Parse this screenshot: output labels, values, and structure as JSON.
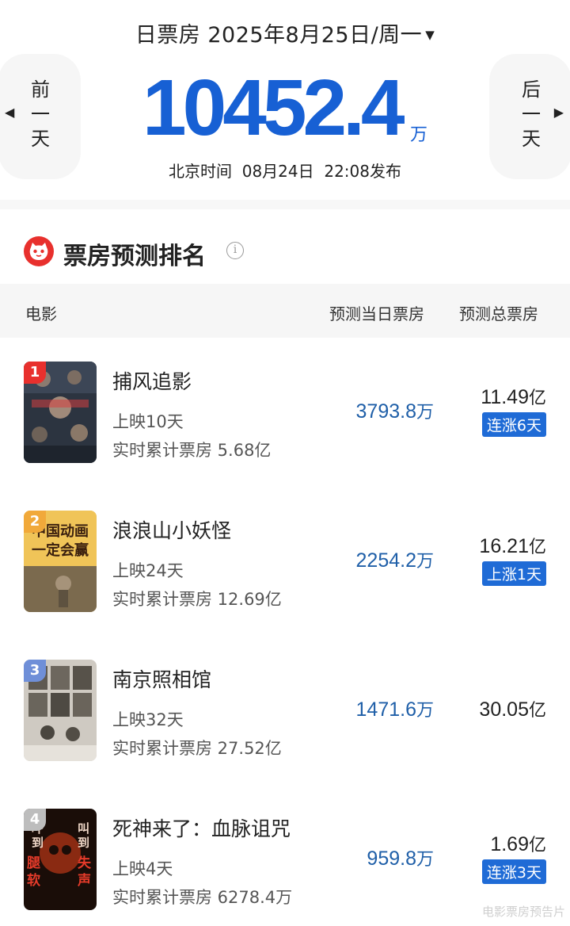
{
  "header": {
    "date_label": "日票房 2025年8月25日/周一",
    "caret": "▼",
    "prev_label": [
      "前",
      "一",
      "天"
    ],
    "next_label": [
      "后",
      "一",
      "天"
    ],
    "prev_arrow": "◀",
    "next_arrow": "▶",
    "total_value": "10452.4",
    "total_unit": "万",
    "release_info": "北京时间  08月24日  22:08发布"
  },
  "section": {
    "title": "票房预测排名",
    "info_glyph": "i"
  },
  "table": {
    "columns": [
      "电影",
      "预测当日票房",
      "预测总票房"
    ],
    "rows": [
      {
        "rank": "1",
        "rank_color": "#e8302d",
        "title": "捕风追影",
        "days": "上映10天",
        "cumulative": "实时累计票房 5.68亿",
        "day_value": "3793.8",
        "day_unit": "万",
        "total_value": "11.49",
        "total_unit": "亿",
        "badge": "连涨6天"
      },
      {
        "rank": "2",
        "rank_color": "#f1a93a",
        "title": "浪浪山小妖怪",
        "days": "上映24天",
        "cumulative": "实时累计票房 12.69亿",
        "day_value": "2254.2",
        "day_unit": "万",
        "total_value": "16.21",
        "total_unit": "亿",
        "badge": "上涨1天"
      },
      {
        "rank": "3",
        "rank_color": "#6f8fd8",
        "title": "南京照相馆",
        "days": "上映32天",
        "cumulative": "实时累计票房 27.52亿",
        "day_value": "1471.6",
        "day_unit": "万",
        "total_value": "30.05",
        "total_unit": "亿",
        "badge": ""
      },
      {
        "rank": "4",
        "rank_color": "#bdbdbd",
        "title": "死神来了：血脉诅咒",
        "days": "上映4天",
        "cumulative": "实时累计票房 6278.4万",
        "day_value": "959.8",
        "day_unit": "万",
        "total_value": "1.69",
        "total_unit": "亿",
        "badge": "连涨3天"
      }
    ]
  },
  "poster_texts": {
    "p2": [
      "中国动画",
      "一定会赢"
    ],
    "p4_left": [
      "吓",
      "到",
      "腿",
      "软"
    ],
    "p4_right": [
      "叫",
      "到",
      "失",
      "声"
    ]
  },
  "watermark": "电影票房预告片",
  "colors": {
    "accent_blue": "#1760d4",
    "value_blue": "#1f5fa8",
    "badge_blue": "#1f6bd6",
    "logo_red": "#e8302d"
  }
}
